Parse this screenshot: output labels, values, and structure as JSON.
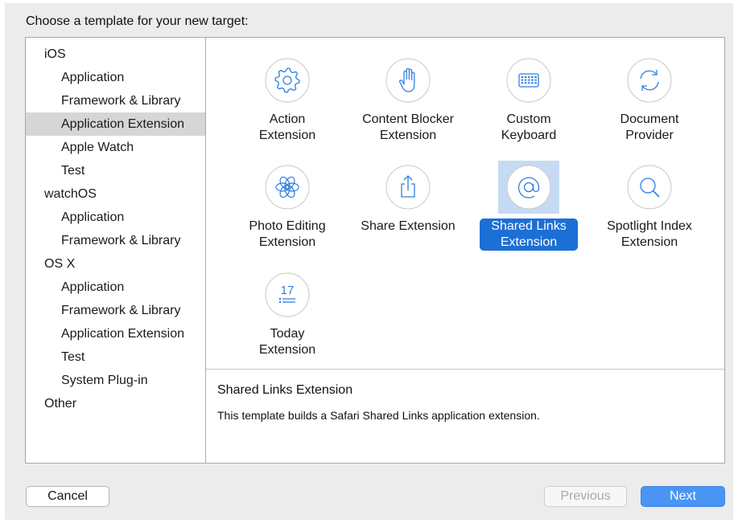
{
  "prompt": "Choose a template for your new target:",
  "sidebar": {
    "items": [
      {
        "label": "iOS",
        "level": "platform",
        "selected": false
      },
      {
        "label": "Application",
        "level": "child",
        "selected": false
      },
      {
        "label": "Framework & Library",
        "level": "child",
        "selected": false
      },
      {
        "label": "Application Extension",
        "level": "child",
        "selected": true
      },
      {
        "label": "Apple Watch",
        "level": "child",
        "selected": false
      },
      {
        "label": "Test",
        "level": "child",
        "selected": false
      },
      {
        "label": "watchOS",
        "level": "platform",
        "selected": false
      },
      {
        "label": "Application",
        "level": "child",
        "selected": false
      },
      {
        "label": "Framework & Library",
        "level": "child",
        "selected": false
      },
      {
        "label": "OS X",
        "level": "platform",
        "selected": false
      },
      {
        "label": "Application",
        "level": "child",
        "selected": false
      },
      {
        "label": "Framework & Library",
        "level": "child",
        "selected": false
      },
      {
        "label": "Application Extension",
        "level": "child",
        "selected": false
      },
      {
        "label": "Test",
        "level": "child",
        "selected": false
      },
      {
        "label": "System Plug-in",
        "level": "child",
        "selected": false
      },
      {
        "label": "Other",
        "level": "platform",
        "selected": false
      }
    ]
  },
  "templates": [
    {
      "line1": "Action",
      "line2": "Extension",
      "icon": "gear-icon",
      "selected": false
    },
    {
      "line1": "Content Blocker",
      "line2": "Extension",
      "icon": "hand-icon",
      "selected": false
    },
    {
      "line1": "Custom",
      "line2": "Keyboard",
      "icon": "keyboard-icon",
      "selected": false
    },
    {
      "line1": "Document",
      "line2": "Provider",
      "icon": "sync-icon",
      "selected": false
    },
    {
      "line1": "Photo Editing",
      "line2": "Extension",
      "icon": "flower-icon",
      "selected": false
    },
    {
      "line1": "Share Extension",
      "line2": "",
      "icon": "share-icon",
      "selected": false
    },
    {
      "line1": "Shared Links",
      "line2": "Extension",
      "icon": "at-sign-icon",
      "selected": true
    },
    {
      "line1": "Spotlight Index",
      "line2": "Extension",
      "icon": "magnifier-icon",
      "selected": false
    },
    {
      "line1": "Today",
      "line2": "Extension",
      "icon": "calendar-17-icon",
      "selected": false
    }
  ],
  "today_icon_number": "17",
  "description": {
    "title": "Shared Links Extension",
    "body": "This template builds a Safari Shared Links application extension."
  },
  "buttons": {
    "cancel": "Cancel",
    "previous": "Previous",
    "next": "Next"
  },
  "colors": {
    "accent": "#1c6fd4",
    "icon_stroke": "#2f7fe0",
    "next_button": "#4a95f3",
    "sidebar_selection": "#d6d6d6"
  }
}
